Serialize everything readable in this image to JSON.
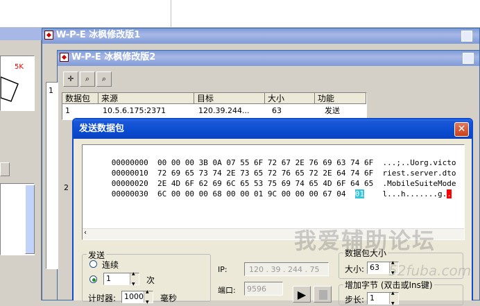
{
  "window1": {
    "title": "W-P-E 冰枫修改版1"
  },
  "window2": {
    "title": "W-P-E 冰枫修改版2"
  },
  "left_panel": {
    "meter_label": "5K"
  },
  "table": {
    "headers": [
      "数据包",
      "来源",
      "目标",
      "大小",
      "功能"
    ],
    "rows": [
      {
        "num": "1",
        "src": "10.5.6.175:2371",
        "dst": "120.39.244...",
        "size": "63",
        "func": "发送"
      }
    ],
    "side_numbers": [
      "1",
      "2"
    ]
  },
  "dialog": {
    "title": "发送数据包",
    "hex_lines": [
      {
        "offset": "00000000",
        "bytes": "00 00 00 3B 0A 07 55 6F 72 67 2E 76 69 63 74 6F",
        "ascii": "...;..Uorg.victo"
      },
      {
        "offset": "00000010",
        "bytes": "72 69 65 73 74 2E 73 65 72 76 65 72 2E 64 74 6F",
        "ascii": "riest.server.dto"
      },
      {
        "offset": "00000020",
        "bytes": "2E 4D 6F 62 69 6C 65 53 75 69 74 65 4D 6F 64 65",
        "ascii": ".MobileSuiteMode"
      },
      {
        "offset": "00000030",
        "bytes": "6C 00 00 00 68 00 00 01 9C 00 00 00 67 04",
        "ascii": "l...h.......g."
      }
    ],
    "selected_byte": "01",
    "send_group": {
      "label": "发送",
      "continuous": "连续",
      "count_value": "1",
      "count_unit": "次",
      "timer_label": "计时器:",
      "timer_value": "1000",
      "timer_unit": "毫秒"
    },
    "ip_label": "IP:",
    "ip_value": "120 . 39 . 244 . 75",
    "port_label": "端口:",
    "port_value": "9596",
    "size_group": {
      "label": "数据包大小",
      "size_label": "大小:",
      "size_value": "63"
    },
    "inc_group": {
      "label": "增加字节 (双击或Ins键)",
      "step_label": "步长:",
      "step_value": "1"
    }
  },
  "watermark": {
    "text": "我爱辅助论坛",
    "sub": "52fuba.com"
  }
}
